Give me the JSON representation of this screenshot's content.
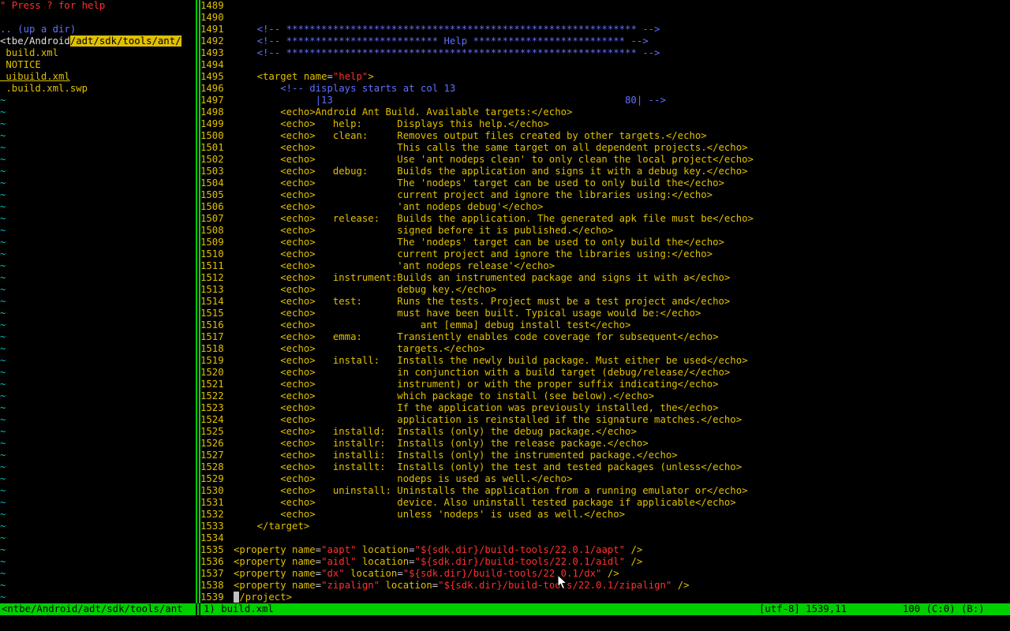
{
  "tree": {
    "help_hint": "\" Press ? for help",
    "up_dir": ".. (up a dir)",
    "path_prefix": "<tbe/Android",
    "path_highlight": "/adt/sdk/tools/ant/",
    "files": [
      " build.xml",
      " NOTICE",
      " uibuild.xml",
      " .build.xml.swp"
    ],
    "tilde": "~"
  },
  "editor": {
    "lines": [
      {
        "n": "1489",
        "html": ""
      },
      {
        "n": "1490",
        "html": ""
      },
      {
        "n": "1491",
        "html": "    <span class='cm'>&lt;!-- ************************************************************ --&gt;</span>"
      },
      {
        "n": "1492",
        "html": "    <span class='cm'>&lt;!-- ************************** Help ************************** --&gt;</span>"
      },
      {
        "n": "1493",
        "html": "    <span class='cm'>&lt;!-- ************************************************************ --&gt;</span>"
      },
      {
        "n": "1494",
        "html": ""
      },
      {
        "n": "1495",
        "html": "    <span class='ec'>&lt;target</span> <span class='at'>name</span>=<span class='st'>\"help\"</span><span class='ec'>&gt;</span>"
      },
      {
        "n": "1496",
        "html": "        <span class='cm'>&lt;!-- displays starts at col 13</span>"
      },
      {
        "n": "1497",
        "html": "<span class='cm'>              |13                                                  80| --&gt;</span>"
      },
      {
        "n": "1498",
        "html": "        <span class='ec'>&lt;echo&gt;</span><span class='tx'>Android Ant Build. Available targets:</span><span class='ec'>&lt;/echo&gt;</span>"
      },
      {
        "n": "1499",
        "html": "        <span class='ec'>&lt;echo&gt;</span><span class='tx'>   help:      Displays this help.</span><span class='ec'>&lt;/echo&gt;</span>"
      },
      {
        "n": "1500",
        "html": "        <span class='ec'>&lt;echo&gt;</span><span class='tx'>   clean:     Removes output files created by other targets.</span><span class='ec'>&lt;/echo&gt;</span>"
      },
      {
        "n": "1501",
        "html": "        <span class='ec'>&lt;echo&gt;</span><span class='tx'>              This calls the same target on all dependent projects.</span><span class='ec'>&lt;/echo&gt;</span>"
      },
      {
        "n": "1502",
        "html": "        <span class='ec'>&lt;echo&gt;</span><span class='tx'>              Use 'ant nodeps clean' to only clean the local project</span><span class='ec'>&lt;/echo&gt;</span>"
      },
      {
        "n": "1503",
        "html": "        <span class='ec'>&lt;echo&gt;</span><span class='tx'>   debug:     Builds the application and signs it with a debug key.</span><span class='ec'>&lt;/echo&gt;</span>"
      },
      {
        "n": "1504",
        "html": "        <span class='ec'>&lt;echo&gt;</span><span class='tx'>              The 'nodeps' target can be used to only build the</span><span class='ec'>&lt;/echo&gt;</span>"
      },
      {
        "n": "1505",
        "html": "        <span class='ec'>&lt;echo&gt;</span><span class='tx'>              current project and ignore the libraries using:</span><span class='ec'>&lt;/echo&gt;</span>"
      },
      {
        "n": "1506",
        "html": "        <span class='ec'>&lt;echo&gt;</span><span class='tx'>              'ant nodeps debug'</span><span class='ec'>&lt;/echo&gt;</span>"
      },
      {
        "n": "1507",
        "html": "        <span class='ec'>&lt;echo&gt;</span><span class='tx'>   release:   Builds the application. The generated apk file must be</span><span class='ec'>&lt;/echo&gt;</span>"
      },
      {
        "n": "1508",
        "html": "        <span class='ec'>&lt;echo&gt;</span><span class='tx'>              signed before it is published.</span><span class='ec'>&lt;/echo&gt;</span>"
      },
      {
        "n": "1509",
        "html": "        <span class='ec'>&lt;echo&gt;</span><span class='tx'>              The 'nodeps' target can be used to only build the</span><span class='ec'>&lt;/echo&gt;</span>"
      },
      {
        "n": "1510",
        "html": "        <span class='ec'>&lt;echo&gt;</span><span class='tx'>              current project and ignore the libraries using:</span><span class='ec'>&lt;/echo&gt;</span>"
      },
      {
        "n": "1511",
        "html": "        <span class='ec'>&lt;echo&gt;</span><span class='tx'>              'ant nodeps release'</span><span class='ec'>&lt;/echo&gt;</span>"
      },
      {
        "n": "1512",
        "html": "        <span class='ec'>&lt;echo&gt;</span><span class='tx'>   instrument:Builds an instrumented package and signs it with a</span><span class='ec'>&lt;/echo&gt;</span>"
      },
      {
        "n": "1513",
        "html": "        <span class='ec'>&lt;echo&gt;</span><span class='tx'>              debug key.</span><span class='ec'>&lt;/echo&gt;</span>"
      },
      {
        "n": "1514",
        "html": "        <span class='ec'>&lt;echo&gt;</span><span class='tx'>   test:      Runs the tests. Project must be a test project and</span><span class='ec'>&lt;/echo&gt;</span>"
      },
      {
        "n": "1515",
        "html": "        <span class='ec'>&lt;echo&gt;</span><span class='tx'>              must have been built. Typical usage would be:</span><span class='ec'>&lt;/echo&gt;</span>"
      },
      {
        "n": "1516",
        "html": "        <span class='ec'>&lt;echo&gt;</span><span class='tx'>                  ant [emma] debug install test</span><span class='ec'>&lt;/echo&gt;</span>"
      },
      {
        "n": "1517",
        "html": "        <span class='ec'>&lt;echo&gt;</span><span class='tx'>   emma:      Transiently enables code coverage for subsequent</span><span class='ec'>&lt;/echo&gt;</span>"
      },
      {
        "n": "1518",
        "html": "        <span class='ec'>&lt;echo&gt;</span><span class='tx'>              targets.</span><span class='ec'>&lt;/echo&gt;</span>"
      },
      {
        "n": "1519",
        "html": "        <span class='ec'>&lt;echo&gt;</span><span class='tx'>   install:   Installs the newly build package. Must either be used</span><span class='ec'>&lt;/echo&gt;</span>"
      },
      {
        "n": "1520",
        "html": "        <span class='ec'>&lt;echo&gt;</span><span class='tx'>              in conjunction with a build target (debug/release/</span><span class='ec'>&lt;/echo&gt;</span>"
      },
      {
        "n": "1521",
        "html": "        <span class='ec'>&lt;echo&gt;</span><span class='tx'>              instrument) or with the proper suffix indicating</span><span class='ec'>&lt;/echo&gt;</span>"
      },
      {
        "n": "1522",
        "html": "        <span class='ec'>&lt;echo&gt;</span><span class='tx'>              which package to install (see below).</span><span class='ec'>&lt;/echo&gt;</span>"
      },
      {
        "n": "1523",
        "html": "        <span class='ec'>&lt;echo&gt;</span><span class='tx'>              If the application was previously installed, the</span><span class='ec'>&lt;/echo&gt;</span>"
      },
      {
        "n": "1524",
        "html": "        <span class='ec'>&lt;echo&gt;</span><span class='tx'>              application is reinstalled if the signature matches.</span><span class='ec'>&lt;/echo&gt;</span>"
      },
      {
        "n": "1525",
        "html": "        <span class='ec'>&lt;echo&gt;</span><span class='tx'>   installd:  Installs (only) the debug package.</span><span class='ec'>&lt;/echo&gt;</span>"
      },
      {
        "n": "1526",
        "html": "        <span class='ec'>&lt;echo&gt;</span><span class='tx'>   installr:  Installs (only) the release package.</span><span class='ec'>&lt;/echo&gt;</span>"
      },
      {
        "n": "1527",
        "html": "        <span class='ec'>&lt;echo&gt;</span><span class='tx'>   installi:  Installs (only) the instrumented package.</span><span class='ec'>&lt;/echo&gt;</span>"
      },
      {
        "n": "1528",
        "html": "        <span class='ec'>&lt;echo&gt;</span><span class='tx'>   installt:  Installs (only) the test and tested packages (unless</span><span class='ec'>&lt;/echo&gt;</span>"
      },
      {
        "n": "1529",
        "html": "        <span class='ec'>&lt;echo&gt;</span><span class='tx'>              nodeps is used as well.</span><span class='ec'>&lt;/echo&gt;</span>"
      },
      {
        "n": "1530",
        "html": "        <span class='ec'>&lt;echo&gt;</span><span class='tx'>   uninstall: Uninstalls the application from a running emulator or</span><span class='ec'>&lt;/echo&gt;</span>"
      },
      {
        "n": "1531",
        "html": "        <span class='ec'>&lt;echo&gt;</span><span class='tx'>              device. Also uninstall tested package if applicable</span><span class='ec'>&lt;/echo&gt;</span>"
      },
      {
        "n": "1532",
        "html": "        <span class='ec'>&lt;echo&gt;</span><span class='tx'>              unless 'nodeps' is used as well.</span><span class='ec'>&lt;/echo&gt;</span>"
      },
      {
        "n": "1533",
        "html": "    <span class='ec'>&lt;/target&gt;</span>"
      },
      {
        "n": "1534",
        "html": ""
      },
      {
        "n": "1535",
        "html": "<span class='ec'>&lt;property</span> <span class='at'>name</span>=<span class='st'>\"aapt\"</span> <span class='at'>location</span>=<span class='st'>\"${sdk.dir}/build-tools/22.0.1/aapt\"</span> <span class='ec'>/&gt;</span>"
      },
      {
        "n": "1536",
        "html": "<span class='ec'>&lt;property</span> <span class='at'>name</span>=<span class='st'>\"aidl\"</span> <span class='at'>location</span>=<span class='st'>\"${sdk.dir}/build-tools/22.0.1/aidl\"</span> <span class='ec'>/&gt;</span>"
      },
      {
        "n": "1537",
        "html": "<span class='ec'>&lt;property</span> <span class='at'>name</span>=<span class='st'>\"dx\"</span> <span class='at'>location</span>=<span class='st'>\"${sdk.dir}/build-tools/22.0.1/dx\"</span> <span class='ec'>/&gt;</span>"
      },
      {
        "n": "1538",
        "html": "<span class='ec'>&lt;property</span> <span class='at'>name</span>=<span class='st'>\"zipalign\"</span> <span class='at'>location</span>=<span class='st'>\"${sdk.dir}/build-tools/22.0.1/zipalign\"</span> <span class='ec'>/&gt;</span>"
      },
      {
        "n": "1539",
        "html": "<span id='cursor'></span><span class='ec'>/project&gt;</span>"
      }
    ]
  },
  "status": {
    "left": "<ntbe/Android/adt/sdk/tools/ant",
    "file": "1) build.xml",
    "position": "[utf-8] 1539,11",
    "scroll": "100 (C:0)  (B:)"
  }
}
